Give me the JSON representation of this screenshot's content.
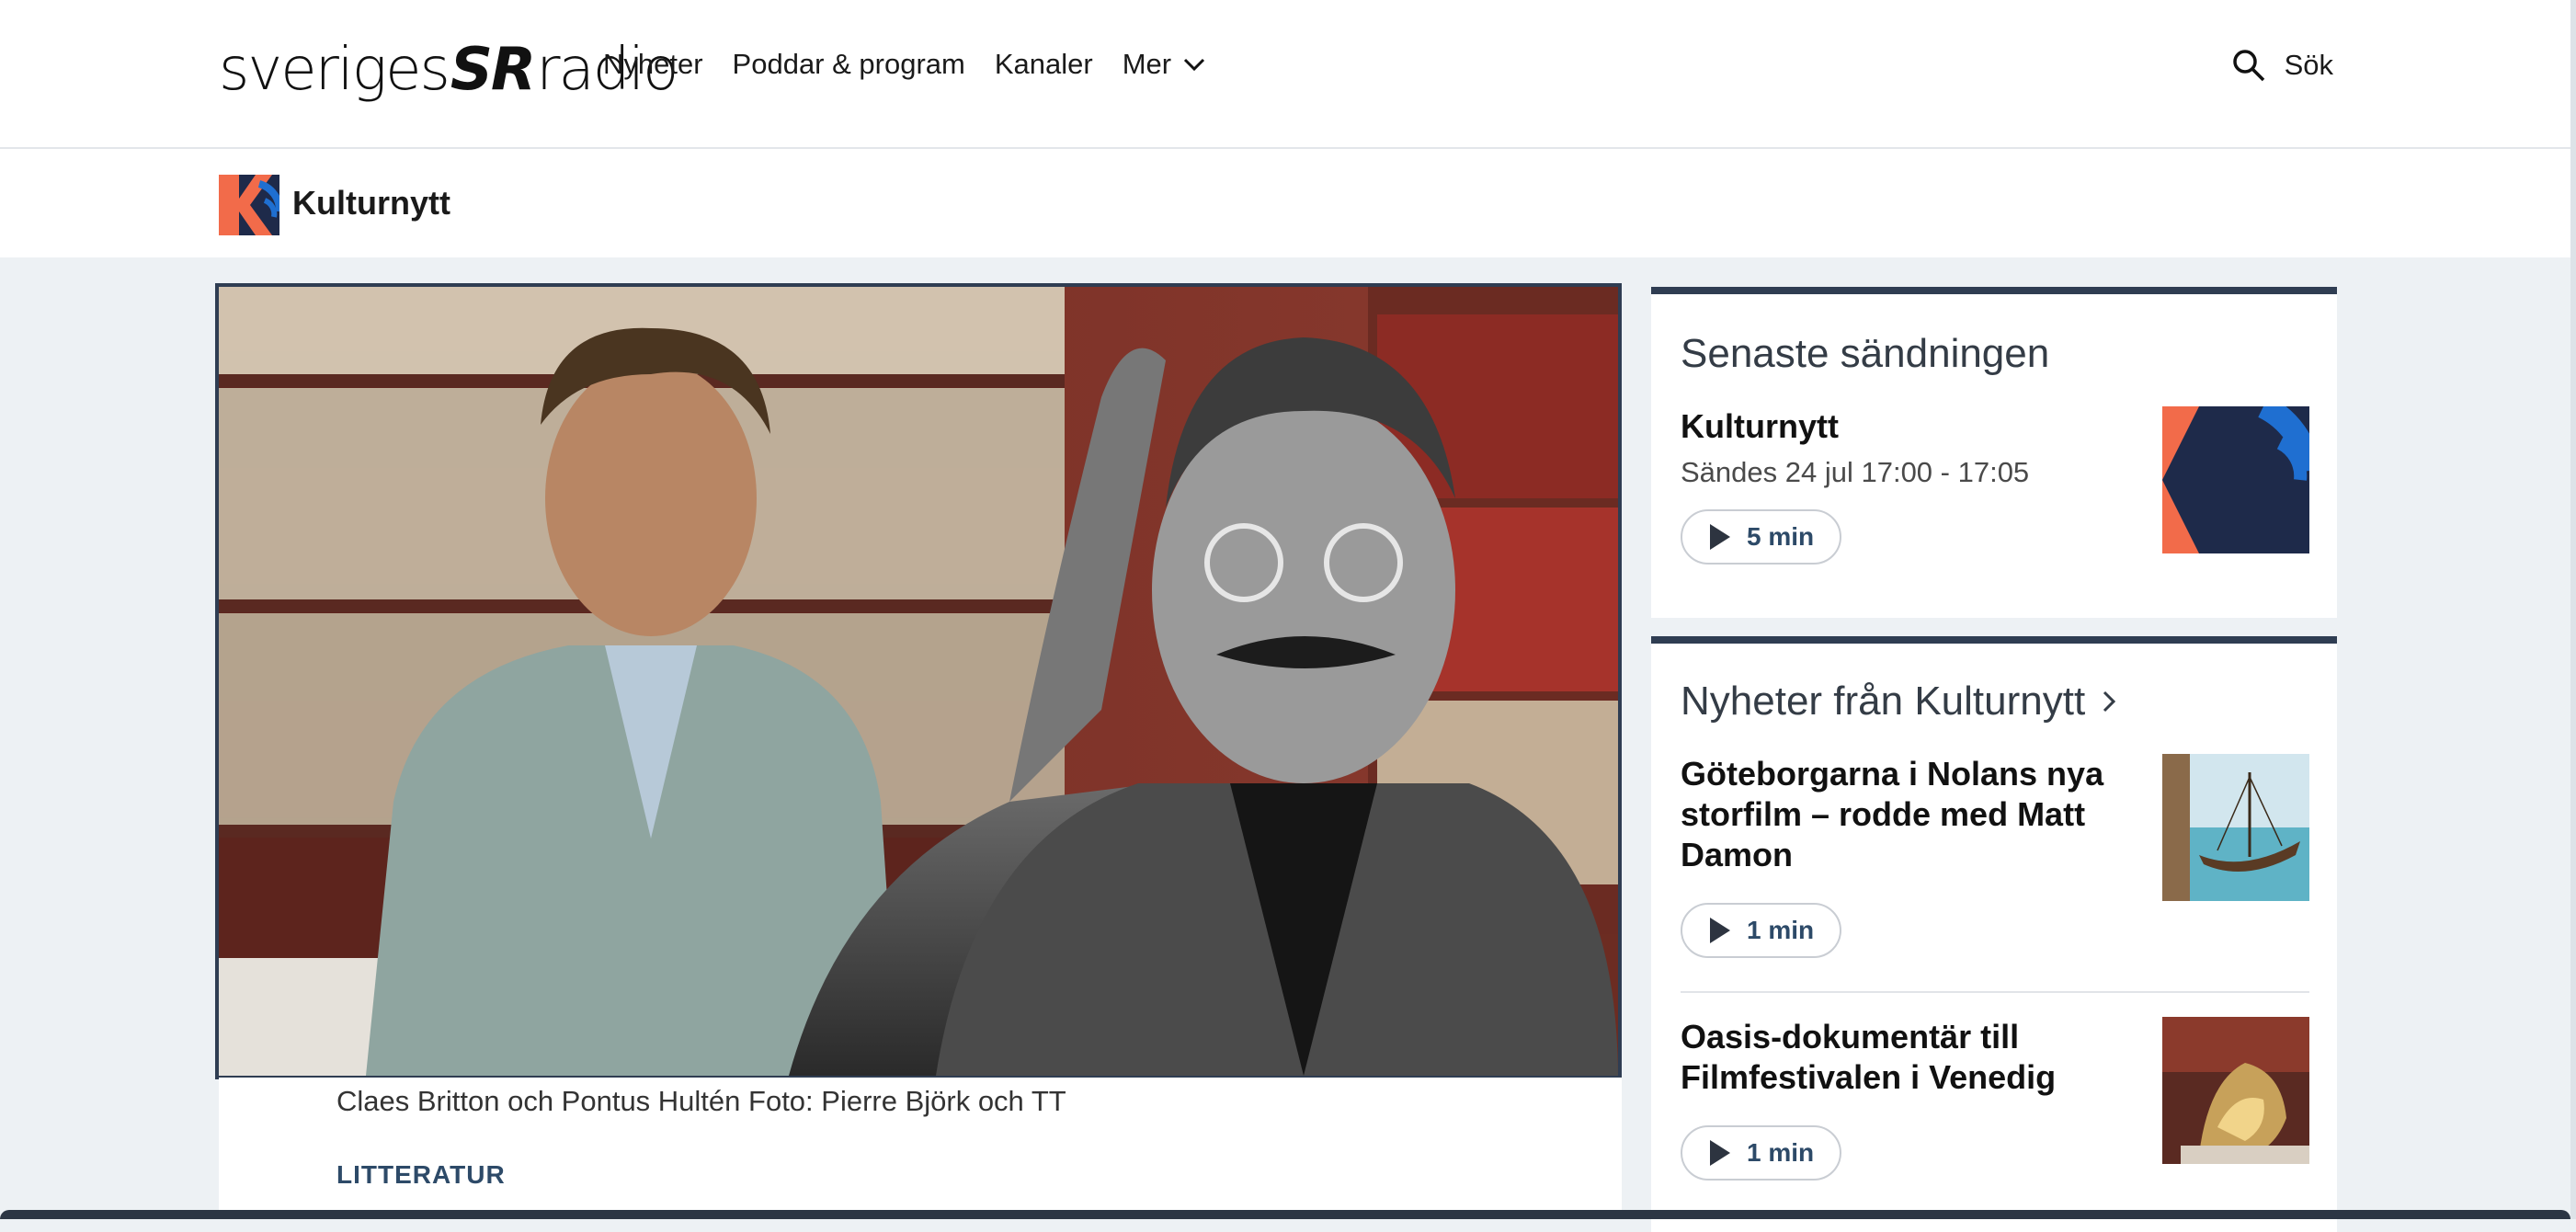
{
  "header": {
    "logo_left": "sveriges",
    "logo_mid": "SR",
    "logo_right": "radio",
    "nav": [
      "Nyheter",
      "Poddar & program",
      "Kanaler",
      "Mer"
    ],
    "search_label": "Sök"
  },
  "program": {
    "name": "Kulturnytt"
  },
  "hero": {
    "caption": "Claes Britton och Pontus Hultén Foto: Pierre Björk och TT",
    "category": "LITTERATUR"
  },
  "latest": {
    "heading": "Senaste sändningen",
    "title": "Kulturnytt",
    "subtitle": "Sändes 24 jul 17:00 - 17:05",
    "duration": "5 min"
  },
  "news": {
    "heading": "Nyheter från Kulturnytt",
    "items": [
      {
        "title": "Göteborgarna i Nolans nya storfilm – rodde med Matt Damon",
        "duration": "1 min"
      },
      {
        "title": "Oasis-dokumentär till Filmfestivalen i Venedig",
        "duration": "1 min"
      }
    ]
  },
  "colors": {
    "accent_orange": "#f26b4a",
    "accent_navy": "#1e2a4a",
    "accent_blue": "#1f6fd1"
  }
}
